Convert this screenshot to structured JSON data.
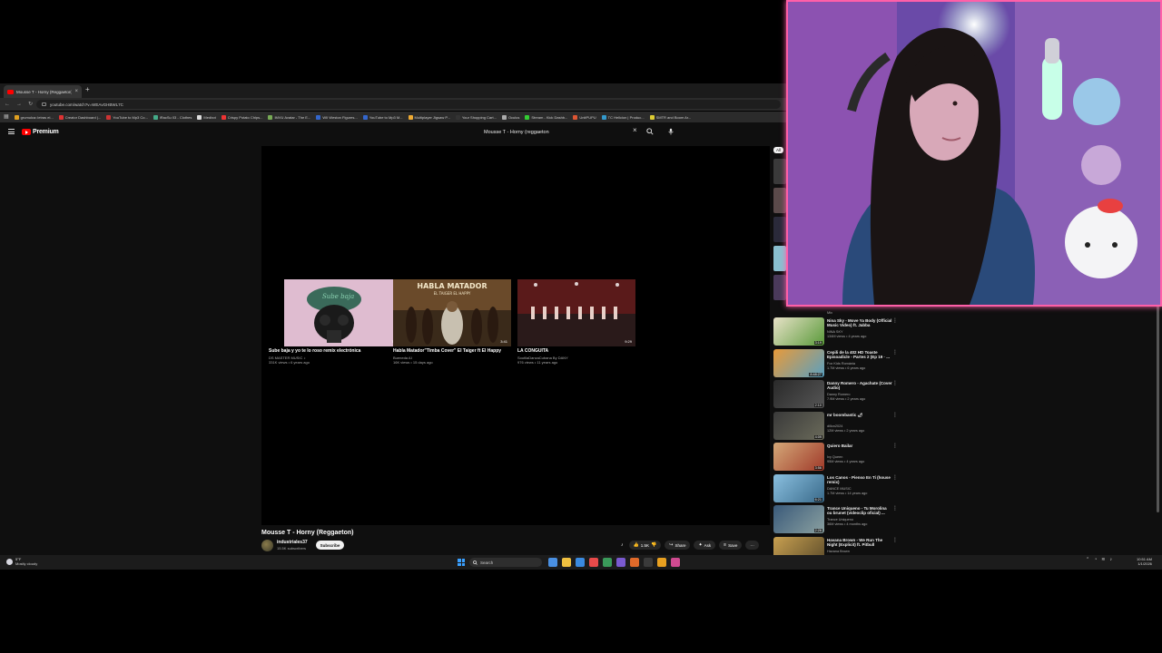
{
  "browser": {
    "tab_title": "Mousse T - Horny (Reggaeton)",
    "tab_close": "×",
    "new_tab": "+",
    "url": "youtube.com/watch?v=WEAvGHBWL7C",
    "bookmarks": [
      {
        "label": "grumulca::letras el...",
        "color": "#e0a020"
      },
      {
        "label": "Creator Dashboard |...",
        "color": "#d33"
      },
      {
        "label": "YouTube to Mp3 Co...",
        "color": "#c33"
      },
      {
        "label": "iRacSu 03 - Clothes",
        "color": "#4a8"
      },
      {
        "label": "Medbot",
        "color": "#ddd"
      },
      {
        "label": "Crispy Potato Chips...",
        "color": "#e33"
      },
      {
        "label": "IMVU Avatar - The E...",
        "color": "#7a5"
      },
      {
        "label": "WII Weston Figures...",
        "color": "#36c"
      },
      {
        "label": "YouTube to Mp3 M...",
        "color": "#36c"
      },
      {
        "label": "Multiplayer Jigsaw P...",
        "color": "#ea3"
      },
      {
        "label": "Your Shopping Cart...",
        "color": "#333"
      },
      {
        "label": "Oculus",
        "color": "#aaa"
      },
      {
        "label": "Stream - Kick Dashb...",
        "color": "#3c3"
      },
      {
        "label": "UnitPUPU",
        "color": "#d53"
      },
      {
        "label": "TC Hellcion | Produc...",
        "color": "#39c"
      },
      {
        "label": "SMTR and Boom Ar...",
        "color": "#dc3"
      }
    ]
  },
  "youtube": {
    "logo_text": "Premium",
    "search_query": "Mousse T - Horny (reggaeton",
    "search_clear": "×",
    "endscreen": [
      {
        "title": "Sube baja y yo te lo roso remix electrónica",
        "channel": "DS MASTER MUSIC ♪",
        "meta": "331K views • 6 years ago",
        "duration": "7:23"
      },
      {
        "title": "Habla Matador\"Timba Cover\" El Taiger ft El Happy",
        "channel": "Bueneda AI",
        "meta": "16K views • 15 days ago",
        "duration": "3:41"
      },
      {
        "title": "LA CONGUITA",
        "channel": "SoutilaDanzaCubana By DANY",
        "meta": "976 views • 11 years ago",
        "duration": "9:29"
      }
    ],
    "thumb_text": {
      "card1": "Sube baja",
      "card2_main": "HABLA MATADOR",
      "card2_sub": "EL TAIGER EL HAPPY"
    },
    "video_title": "Mousse T - Horny (Reggaeton)",
    "channel_name": "industriales37",
    "channel_subs": "15.5K subscribers",
    "subscribe_label": "Subscribe",
    "actions": {
      "like_count": "1.5K",
      "share": "Share",
      "ask": "Ask",
      "save": "Save",
      "more": "···"
    },
    "chip_all": "All",
    "partial_rec_meta": "Mix",
    "recommendations": [
      {
        "title": "Nina Sky - Move Ya Body (Official Music Video) ft. Jabba",
        "channel": "NINA SKY",
        "meta": "134M views • 4 years ago",
        "duration": "3:19",
        "c1": "#e8e2c8",
        "c2": "#5a9a3a"
      },
      {
        "title": "Cepili de la 402 HD Toaste Episoadicle - Partes 2 (Ep 19 · ...",
        "channel": "Fox Kids Románia",
        "meta": "1.7M views • 6 years ago",
        "duration": "8:48:27",
        "c1": "#e89a3a",
        "c2": "#5aa0c0"
      },
      {
        "title": "Danny Romero - Agachate (Cover Audio)",
        "channel": "Danny Romero",
        "meta": "7.9M views • 2 years ago",
        "duration": "2:10",
        "c1": "#2a2a2a",
        "c2": "#555"
      },
      {
        "title": "mr boombastic 🌶",
        "channel": "dillon2024",
        "meta": "12M views • 2 years ago",
        "duration": "4:09",
        "c1": "#3a3a3a",
        "c2": "#6a6a5a"
      },
      {
        "title": "Quiero Bailar",
        "channel": "Ivy Queen",
        "meta": "95M views • 4 years ago",
        "duration": "3:56",
        "c1": "#d4a878",
        "c2": "#a03a2a"
      },
      {
        "title": "Los Canos - Pienso En Ti (house remix)",
        "channel": "DANCE MUSIC",
        "meta": "1.7M views • 14 years ago",
        "duration": "6:21",
        "c1": "#8ac0e0",
        "c2": "#3a6a8a"
      },
      {
        "title": "Trance Uniqueno - Tu Morolina ou brunet (videoclip oficial) ...",
        "channel": "Trance Uniqueno",
        "meta": "36M views • 4 months ago",
        "duration": "2:26",
        "c1": "#3a5a7a",
        "c2": "#8aa0a0"
      },
      {
        "title": "Havana Brown - We Run The Night (Explicit) ft. Pitbull",
        "channel": "Havana Brown",
        "meta": "",
        "duration": "",
        "c1": "#c8a050",
        "c2": "#5a4a2a"
      }
    ]
  },
  "taskbar": {
    "temperature": "5°F",
    "condition": "Mostly cloudy",
    "search_placeholder": "Search",
    "time": "10:51 AM",
    "date": "1/1/2026",
    "apps": [
      "#4a90e2",
      "#f0c040",
      "#3a8ae0",
      "#e84a4a",
      "#3a9a5a",
      "#7a5ad0",
      "#e06a2a",
      "#3a3a3a",
      "#e8a020",
      "#d04a90"
    ]
  },
  "colors": {
    "webcam_border": "#ff5fa8",
    "youtube_red": "#ff0000",
    "windows_blue": "#3aa0ff"
  }
}
